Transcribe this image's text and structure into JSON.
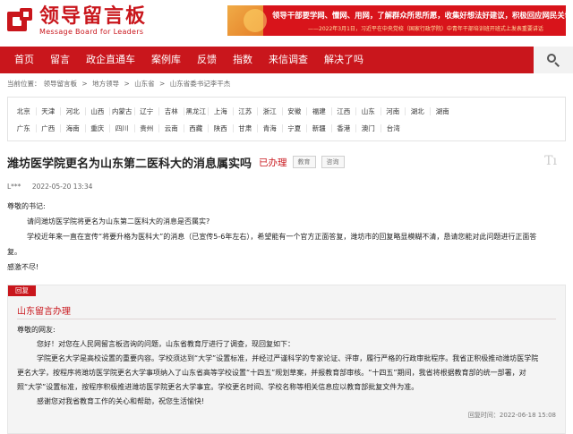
{
  "logo": {
    "cn": "领导留言板",
    "en": "Message Board for Leaders",
    "brand_color": "#c9161c"
  },
  "banner": {
    "line1": "领导干部要学网、懂网、用网，了解群众所思所愿，收集好想法好建议，积极回应网民关切。",
    "line2": "——2022年3月1日，习近平在中央党校（国家行政学院）中青年干部培训班开班式上发表重要讲话"
  },
  "nav": {
    "items": [
      "首页",
      "留言",
      "政企直通车",
      "案例库",
      "反馈",
      "指数",
      "来信调查",
      "解决了吗"
    ],
    "search_icon": "search-icon"
  },
  "breadcrumb": {
    "prefix": "当前位置：",
    "items": [
      "领导留言板",
      "地方领导",
      "山东省",
      "山东省委书记李干杰"
    ],
    "separator": ">"
  },
  "regions": {
    "row1": [
      "北京",
      "天津",
      "河北",
      "山西",
      "内蒙古",
      "辽宁",
      "吉林",
      "黑龙江",
      "上海",
      "江苏",
      "浙江",
      "安徽",
      "福建",
      "江西",
      "山东",
      "河南",
      "湖北",
      "湖南"
    ],
    "row2": [
      "广东",
      "广西",
      "海南",
      "重庆",
      "四川",
      "贵州",
      "云南",
      "西藏",
      "陕西",
      "甘肃",
      "青海",
      "宁夏",
      "新疆",
      "香港",
      "澳门",
      "台湾"
    ]
  },
  "message": {
    "title": "潍坊医学院更名为山东第二医科大的消息属实吗",
    "status": "已办理",
    "tags": [
      "教育",
      "咨询"
    ],
    "author": "L***",
    "time": "2022-05-20 13:34",
    "greeting": "尊敬的书记:",
    "para1": "请问潍坊医学院将更名为山东第二医科大的消息是否属实?",
    "para2": "学校近年来一直在宣传“将要升格为医科大”的消息（已宣传5-6年左右），希望能有一个官方正面答复，潍坊市的回复略显模糊不清，恳请您能对此问题进行正面答",
    "para2_end": "复。",
    "closing": "感激不尽!"
  },
  "reply": {
    "tag": "回复",
    "org": "山东留言办理",
    "greeting": "尊敬的网友:",
    "para1": "您好！对您在人民网留言板咨询的问题，山东省教育厅进行了调查，现回复如下：",
    "para2_l1": "学院更名大学是高校设置的重要内容。学校须达到“大学”设置标准，并经过严谨科学的专家论证、评审，履行严格的行政审批程序。我省正积极推动潍坊医学院",
    "para2_l2": "更名大学，按程序将潍坊医学院更名大学事项纳入了山东省高等学校设置“十四五”规划草案，并报教育部审核。“十四五”期间，我省将根据教育部的统一部署，对",
    "para2_l3": "照“大学”设置标准，按程序积极推进潍坊医学院更名大学事宜。学校更名时间、学校名称等相关信息应以教育部批复文件为准。",
    "para3": "感谢您对我省教育工作的关心和帮助，祝您生活愉快!",
    "time": "回复时间：2022-06-18 15:08"
  }
}
